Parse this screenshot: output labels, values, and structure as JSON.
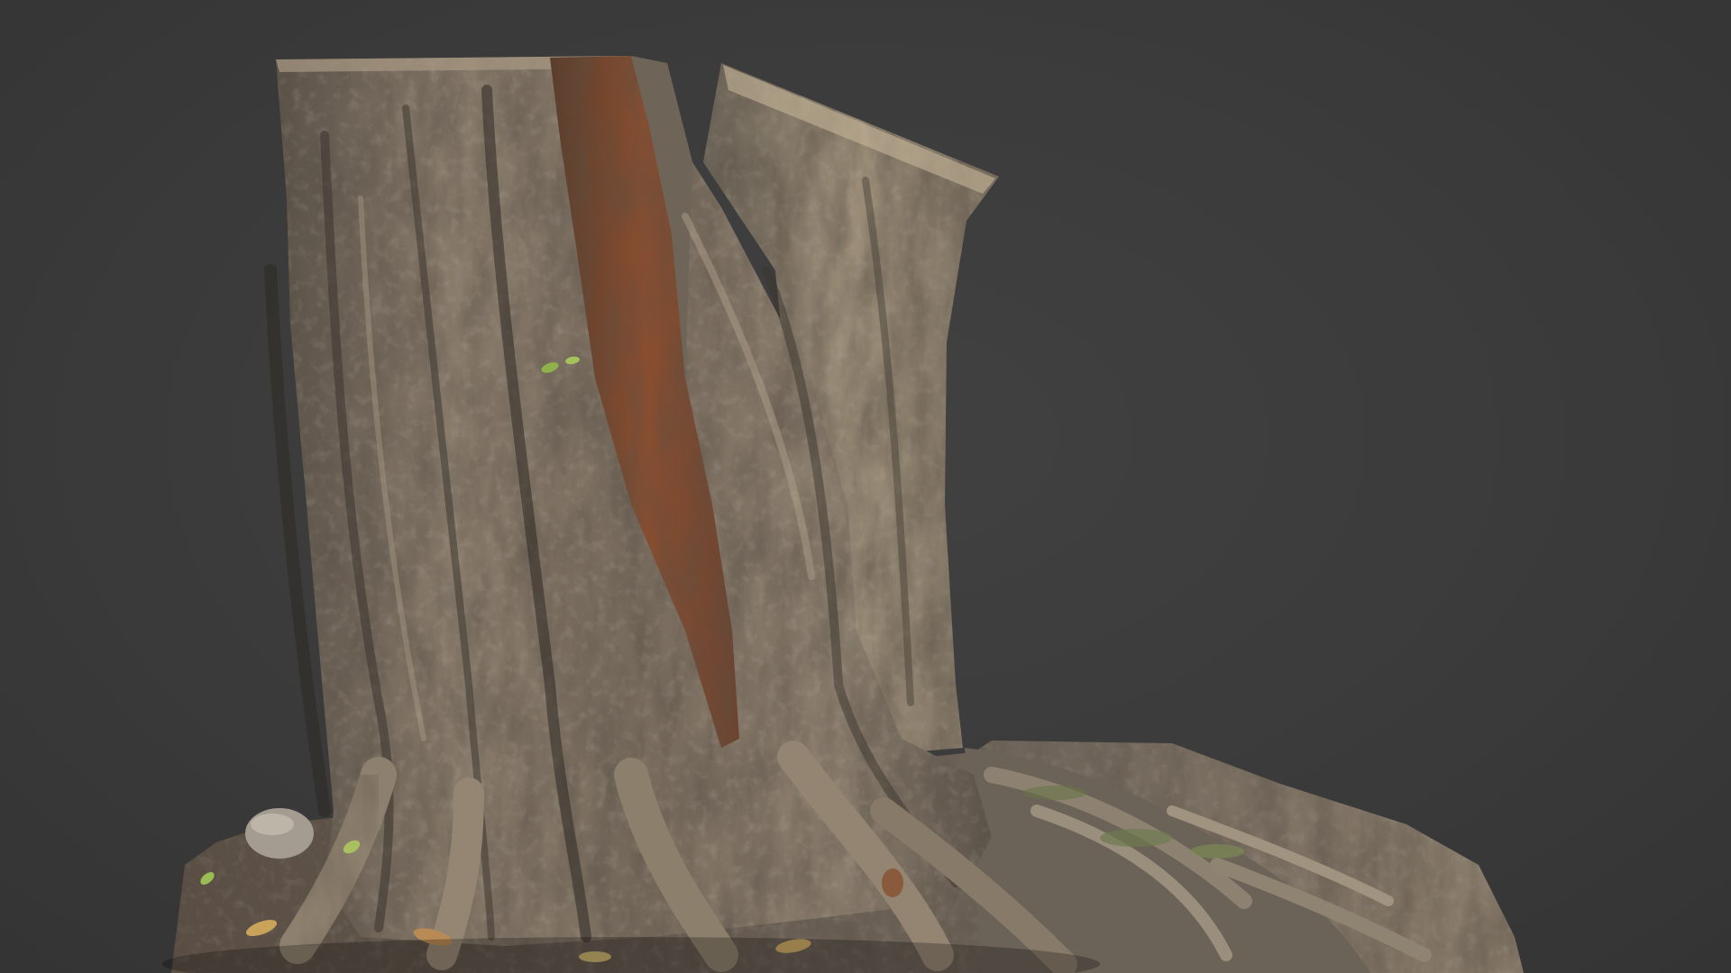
{
  "scene": {
    "subject": "tree-stump-3d-scan",
    "colors": {
      "background": "#3a3a3a",
      "bark_light": "#a1917c",
      "bark_mid": "#7d7062",
      "bark_dark": "#4f473f",
      "heartwood": "#8a4a2a",
      "moss": "#6d7a4e",
      "ground": "#5e5045",
      "leaf": "#c9a35a",
      "leaf_green": "#8fb04a"
    }
  }
}
